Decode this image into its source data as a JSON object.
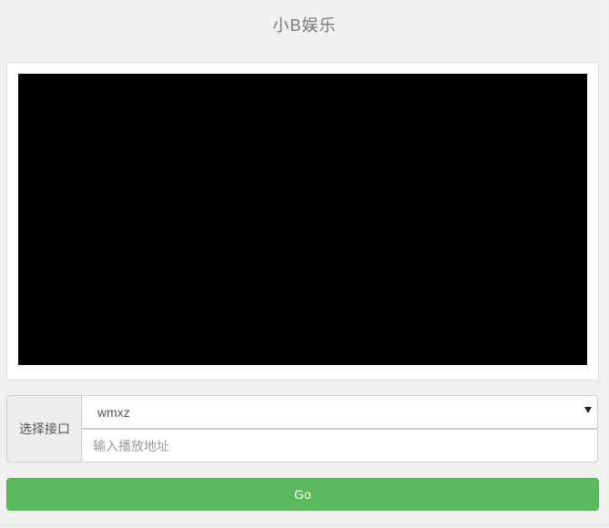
{
  "header": {
    "title": "小B娱乐"
  },
  "player": {
    "background_color": "#000000"
  },
  "form": {
    "interface_label": "选择接口",
    "interface_selected": "wmxz",
    "url_placeholder": "输入播放地址",
    "url_value": ""
  },
  "actions": {
    "go_label": "Go",
    "go_color": "#5cb85c"
  }
}
